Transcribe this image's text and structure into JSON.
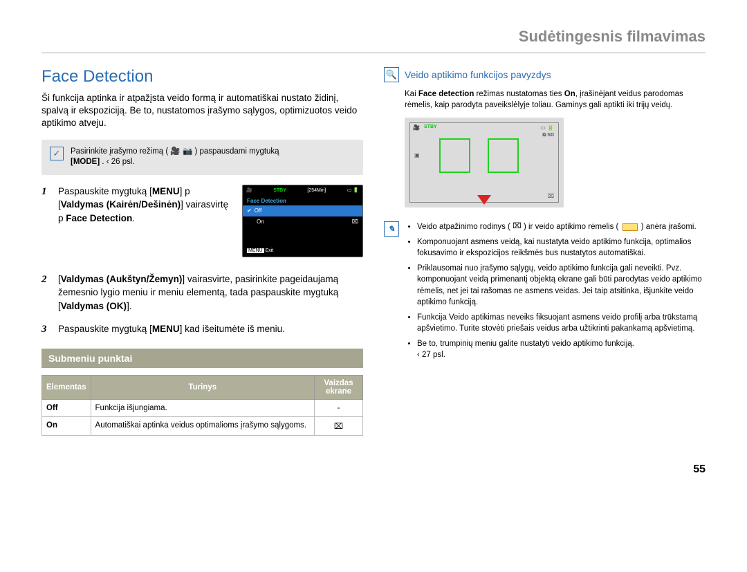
{
  "header": "Sudėtingesnis filmavimas",
  "page_number": "55",
  "left": {
    "title": "Face Detection",
    "intro": "Ši funkcija aptinka ir atpažįsta veido formą ir automatiškai nustato židinį, spalvą ir ekspoziciją. Be to, nustatomos įrašymo sąlygos, optimizuotos veido aptikimo atveju.",
    "hint_pre": "Pasirinkite įrašymo režimą ( ",
    "hint_post": " ) paspausdami mygtuką ",
    "hint_mode": "[MODE]",
    "hint_pg": ".  ‹ 26 psl.",
    "steps": {
      "s1a": "Paspauskite mygtuką [",
      "s1_menu": "MENU",
      "s1b": "] p [",
      "s1_valdymas": "Valdymas (Kairėn/Dešinėn)",
      "s1c": "] vairasvirtę  p ",
      "s1_fd": "Face Detection",
      "s1d": ".",
      "s2a": "[",
      "s2_valdymas": "Valdymas (Aukštyn/Žemyn)",
      "s2b": "] vairasvirte, pasirinkite pageidaujamą žemesnio lygio meniu ir meniu elementą, tada paspauskite mygtuką [",
      "s2_ok": "Valdymas (OK)",
      "s2c": "].",
      "s3a": "Paspauskite mygtuką [",
      "s3_menu": "MENU",
      "s3b": "] kad išeitumėte iš meniu."
    },
    "menu_shot": {
      "stby": "STBY",
      "time": "[254Min]",
      "title": "Face Detection",
      "off": "Off",
      "on": "On",
      "exit_tag": "MENU",
      "exit": "Exit"
    },
    "submenu_heading": "Submeniu punktai",
    "table": {
      "h1": "Elementas",
      "h2": "Turinys",
      "h3": "Vaizdas ekrane",
      "r1c1": "Off",
      "r1c2": "Funkcija išjungiama.",
      "r1c3": "-",
      "r2c1": "On",
      "r2c2": "Automatiškai aptinka veidus optimalioms įrašymo sąlygoms.",
      "r2c3": "⌧"
    }
  },
  "right": {
    "heading": "Veido aptikimo funkcijos pavyzdys",
    "intro_a": "Kai ",
    "intro_b": "Face detection",
    "intro_c": " režimas nustatomas ties ",
    "intro_d": "On",
    "intro_e": ", įrašinėjant veidus parodomas rėmelis, kaip parodyta paveikslėlyje toliau. Gaminys gali aptikti iki trijų veidų.",
    "shot": {
      "stby": "STBY",
      "sd": "⧉ SD"
    },
    "notes": {
      "n1a": "Veido atpažinimo rodinys ( ",
      "n1b": " ) ir veido aptikimo rėmelis ( ",
      "n1c": " ) anėra įrašomi.",
      "n2": "Komponuojant asmens veidą, kai nustatyta veido aptikimo funkcija, optimalios fokusavimo ir ekspozicijos reikšmės bus nustatytos automatiškai.",
      "n3": "Priklausomai nuo įrašymo sąlygų, veido aptikimo funkcija gali neveikti. Pvz. komponuojant veidą primenantį objektą ekrane gali būti parodytas veido aptikimo rėmelis, net jei tai rašomas ne asmens veidas. Jei taip atsitinka, išjunkite veido aptikimo funkciją.",
      "n4": "Funkcija Veido aptikimas neveiks fiksuojant asmens veido profilį arba trūkstamą apšvietimo. Turite stovėti priešais veidus arba užtikrinti pakankamą apšvietimą.",
      "n5a": "Be to, trumpinių meniu galite nustatyti veido aptikimo funkciją.",
      "n5b": "‹ 27 psl."
    }
  }
}
